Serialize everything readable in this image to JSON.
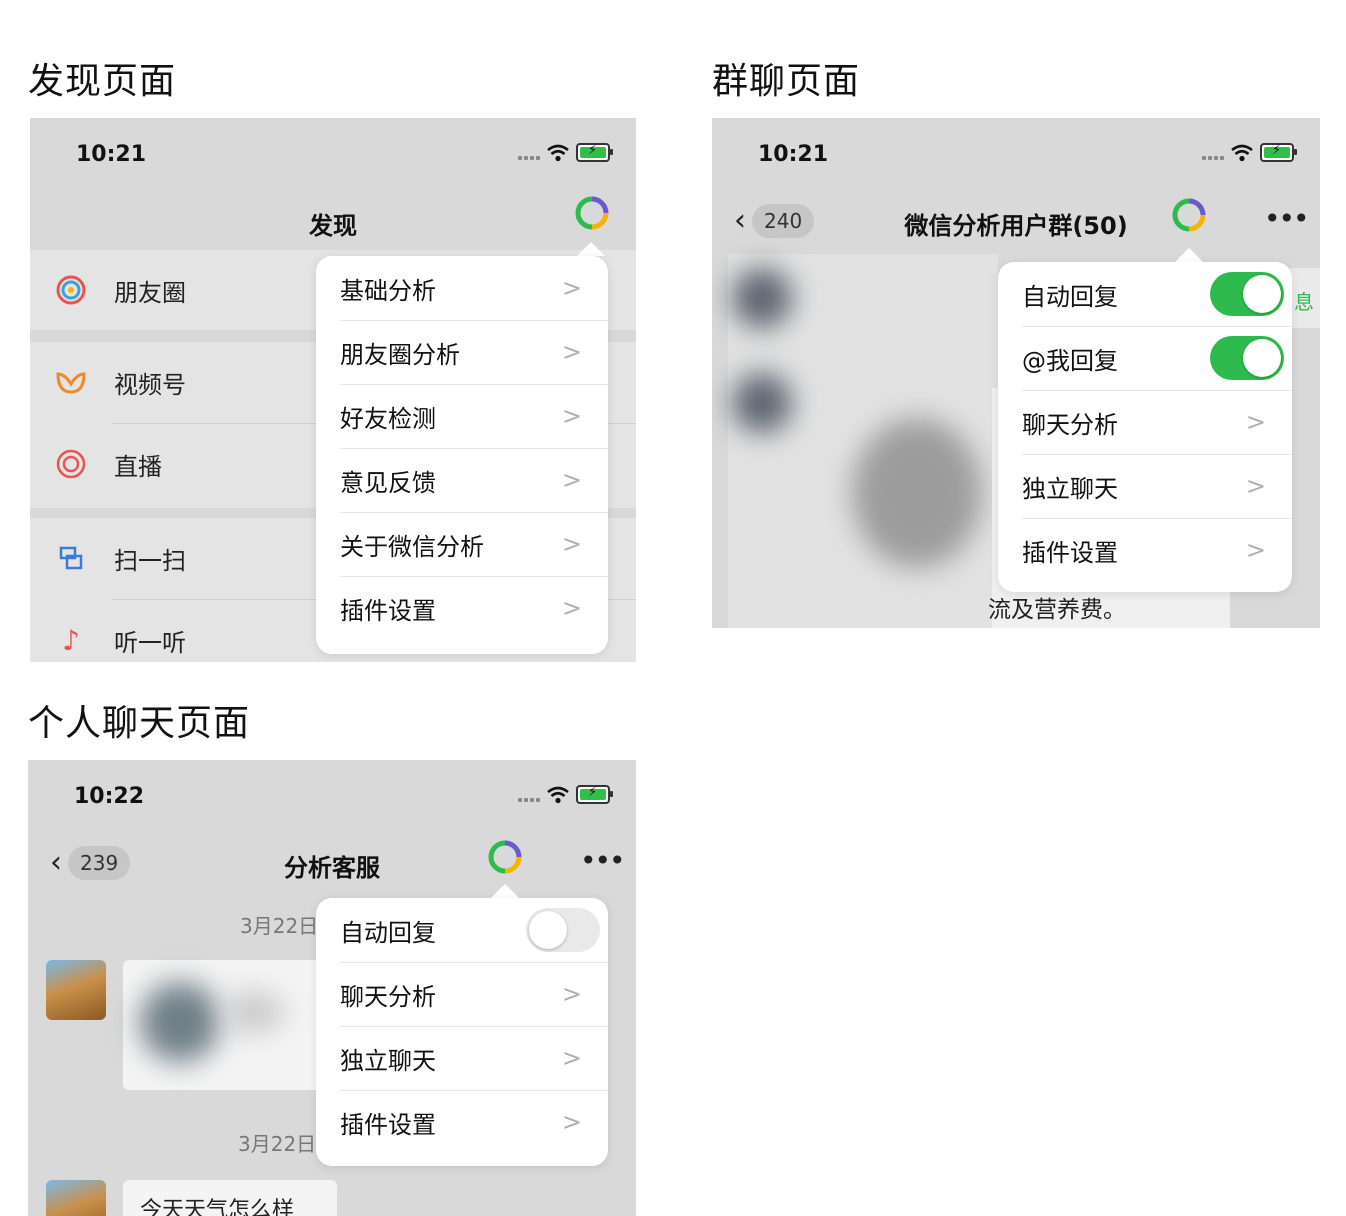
{
  "sections": {
    "discover": "发现页面",
    "group": "群聊页面",
    "personal": "个人聊天页面"
  },
  "discover": {
    "time": "10:21",
    "nav_title": "发现",
    "rows": [
      {
        "label": "朋友圈",
        "icon": "moments-icon"
      },
      {
        "label": "视频号",
        "icon": "channels-icon"
      },
      {
        "label": "直播",
        "icon": "live-icon"
      },
      {
        "label": "扫一扫",
        "icon": "scan-icon"
      },
      {
        "label": "听一听",
        "icon": "music-icon"
      }
    ],
    "menu": [
      {
        "label": "基础分析"
      },
      {
        "label": "朋友圈分析"
      },
      {
        "label": "好友检测"
      },
      {
        "label": "意见反馈"
      },
      {
        "label": "关于微信分析"
      },
      {
        "label": "插件设置"
      }
    ]
  },
  "group": {
    "time": "10:21",
    "back_count": "240",
    "nav_title": "微信分析用户群(50)",
    "peek_text": "流及营养费。",
    "side_text": "息",
    "menu": [
      {
        "label": "自动回复",
        "toggle": true
      },
      {
        "label": "@我回复",
        "toggle": true
      },
      {
        "label": "聊天分析"
      },
      {
        "label": "独立聊天"
      },
      {
        "label": "插件设置"
      }
    ]
  },
  "personal": {
    "time": "10:22",
    "back_count": "239",
    "nav_title": "分析客服",
    "date1": "3月22日",
    "date2": "3月22日",
    "bottom_text": "今天天气怎么样",
    "menu": [
      {
        "label": "自动回复",
        "toggle": false
      },
      {
        "label": "聊天分析"
      },
      {
        "label": "独立聊天"
      },
      {
        "label": "插件设置"
      }
    ]
  },
  "colors": {
    "toggle_on": "#2dbb4e",
    "plugin_ring": [
      "#2dbb4e",
      "#6a5acd",
      "#f5b400"
    ]
  }
}
